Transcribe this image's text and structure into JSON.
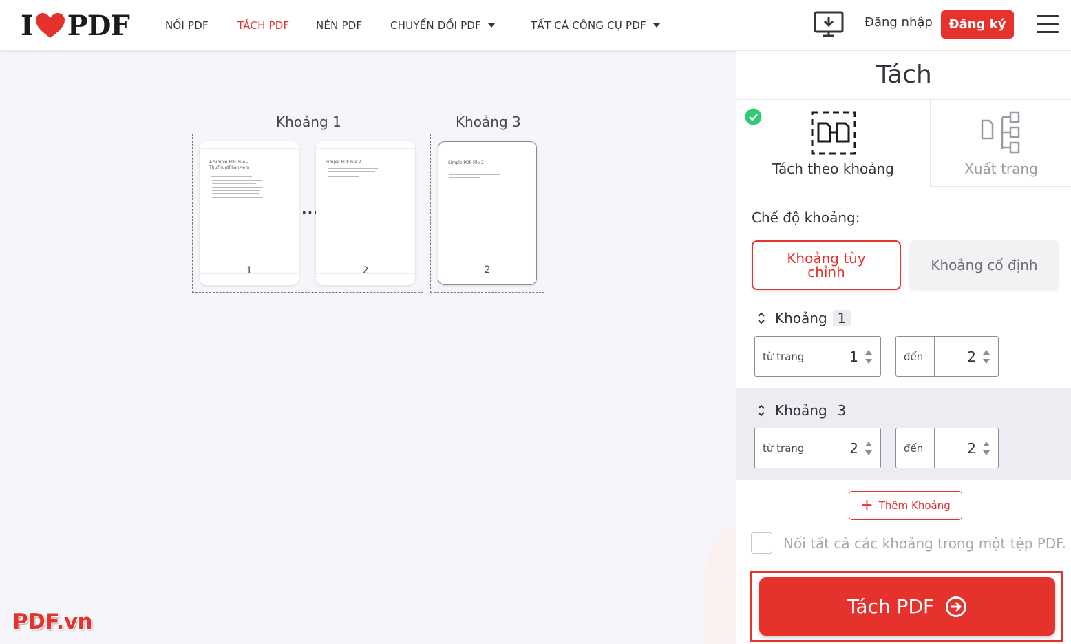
{
  "header": {
    "logo_left": "I",
    "logo_right": "PDF",
    "nav": [
      {
        "label": "NỐI PDF",
        "active": false
      },
      {
        "label": "TÁCH PDF",
        "active": true
      },
      {
        "label": "NÉN PDF",
        "active": false
      },
      {
        "label": "CHUYỂN ĐỔI PDF",
        "active": false,
        "dropdown": true
      },
      {
        "label": "TẤT CẢ CÔNG CỤ PDF",
        "active": false,
        "dropdown": true
      }
    ],
    "download_icon": "desktop-download-icon",
    "login_label": "Đăng nhập",
    "signup_label": "Đăng ký",
    "menu_icon": "hamburger-icon"
  },
  "workspace": {
    "ranges": [
      {
        "label": "Khoảng 1",
        "pages": [
          {
            "number": "1",
            "doc_title": "A Simple PDF File - ThuThuatPhanMem"
          },
          {
            "number": "2",
            "doc_title": "Simple PDF File 2"
          }
        ]
      },
      {
        "label": "Khoảng 3",
        "pages": [
          {
            "number": "2",
            "doc_title": "Simple PDF File 2"
          }
        ]
      }
    ],
    "ellipsis": "..."
  },
  "sidebar": {
    "title": "Tách",
    "modes": [
      {
        "label": "Tách theo khoảng",
        "selected": true,
        "icon": "split-range-icon"
      },
      {
        "label": "Xuất trang",
        "selected": false,
        "icon": "extract-pages-icon"
      }
    ],
    "range_mode_label": "Chế độ khoảng:",
    "range_modes": [
      {
        "label": "Khoảng tùy chỉnh",
        "selected": true
      },
      {
        "label": "Khoảng cố định",
        "selected": false
      }
    ],
    "range_items": [
      {
        "title": "Khoảng",
        "number": "1",
        "from_label": "từ trang",
        "from_value": "1",
        "to_label": "đến",
        "to_value": "2"
      },
      {
        "title": "Khoảng",
        "number": "3",
        "from_label": "từ trang",
        "from_value": "2",
        "to_label": "đến",
        "to_value": "2"
      }
    ],
    "add_range_label": "Thêm Khoảng",
    "merge_label": "Nối tất cả các khoảng trong một tệp PDF.",
    "merge_checked": false,
    "submit_label": "Tách PDF"
  },
  "watermark": "PDF.vn",
  "colors": {
    "brand": "#e5322d",
    "success": "#2ecc71"
  }
}
